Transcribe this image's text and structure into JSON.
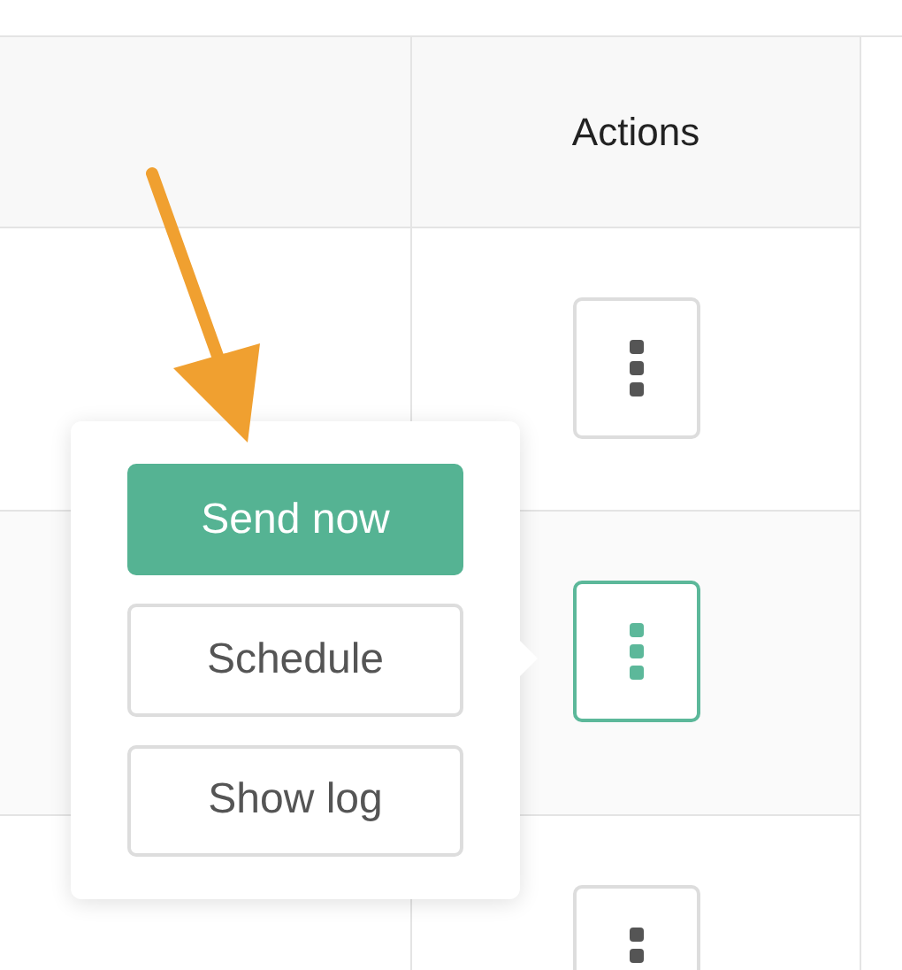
{
  "table": {
    "columns": [
      {
        "kind": "blank"
      },
      {
        "kind": "text",
        "label": "Actions"
      }
    ],
    "rows": [
      {
        "menu_open": false
      },
      {
        "menu_open": true
      },
      {
        "menu_open": false
      }
    ]
  },
  "menu": {
    "items": [
      {
        "label": "Send now",
        "kind": "primary"
      },
      {
        "label": "Schedule",
        "kind": "secondary"
      },
      {
        "label": "Show log",
        "kind": "secondary"
      }
    ]
  },
  "annotation": {
    "kind": "arrow"
  }
}
